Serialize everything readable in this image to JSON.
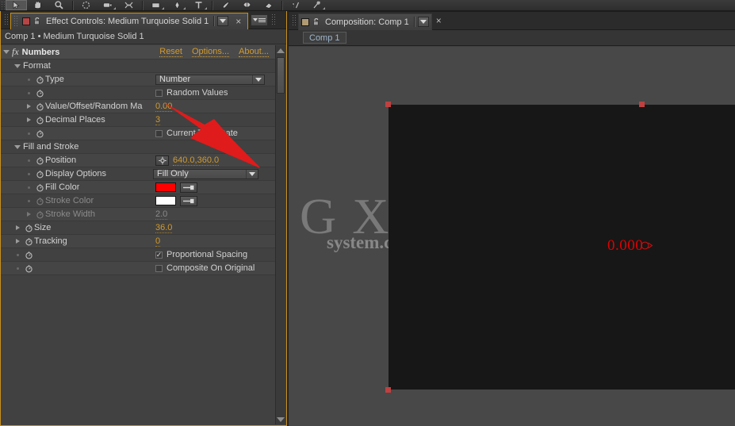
{
  "toolbar": {
    "name": "tools-toolbar",
    "tools": [
      {
        "name": "selection-tool",
        "icon": "arrow-cursor",
        "selected": true
      },
      {
        "name": "hand-tool",
        "icon": "hand"
      },
      {
        "name": "zoom-tool",
        "icon": "magnifier"
      },
      {
        "name": "rotation-tool",
        "icon": "rotate"
      },
      {
        "name": "camera-tool",
        "icon": "camera",
        "has_corner": true
      },
      {
        "name": "pan-behind-tool",
        "icon": "pan-behind"
      },
      {
        "name": "shape-tool",
        "icon": "rectangle",
        "has_corner": true
      },
      {
        "name": "pen-tool",
        "icon": "pen",
        "has_corner": true
      },
      {
        "name": "type-tool",
        "icon": "text-t",
        "has_corner": true
      },
      {
        "name": "brush-tool",
        "icon": "brush"
      },
      {
        "name": "clone-stamp-tool",
        "icon": "clone-stamp"
      },
      {
        "name": "eraser-tool",
        "icon": "eraser"
      },
      {
        "name": "roto-brush-tool",
        "icon": "roto-brush"
      },
      {
        "name": "puppet-pin-tool",
        "icon": "puppet-pin",
        "has_corner": true
      }
    ]
  },
  "effect_controls": {
    "tab_title": "Effect Controls: Medium Turquoise Solid 1",
    "breadcrumb": "Comp 1 • Medium Turquoise Solid 1",
    "close_glyph": "×",
    "effect": {
      "name": "Numbers",
      "fx_badge": "fx",
      "links": [
        {
          "name": "reset-link",
          "label": "Reset"
        },
        {
          "name": "options-link",
          "label": "Options..."
        },
        {
          "name": "about-link",
          "label": "About..."
        }
      ]
    },
    "groups": [
      {
        "name": "Format",
        "rows": [
          {
            "label": "Type",
            "kind": "select",
            "value": "Number"
          },
          {
            "label": "",
            "kind": "checkbox",
            "value": "Random Values",
            "checked": false
          },
          {
            "label": "Value/Offset/Random Ma",
            "kind": "value",
            "value": "0.00",
            "expandable": true
          },
          {
            "label": "Decimal Places",
            "kind": "value",
            "value": "3",
            "expandable": true
          },
          {
            "label": "",
            "kind": "checkbox",
            "value": "Current Time/Date",
            "checked": false
          }
        ]
      },
      {
        "name": "Fill and Stroke",
        "rows": [
          {
            "label": "Position",
            "kind": "position",
            "value": "640.0,360.0"
          },
          {
            "label": "Display Options",
            "kind": "select",
            "value": "Fill Only"
          },
          {
            "label": "Fill Color",
            "kind": "color",
            "value": "#ff0000"
          },
          {
            "label": "Stroke Color",
            "kind": "color",
            "value": "#ffffff",
            "disabled": true
          },
          {
            "label": "Stroke Width",
            "kind": "value",
            "value": "2.0",
            "expandable": true,
            "disabled": true
          },
          {
            "label": "Size",
            "kind": "value",
            "value": "36.0",
            "expandable": true,
            "indent": 0
          },
          {
            "label": "Tracking",
            "kind": "value",
            "value": "0",
            "expandable": true,
            "indent": 0
          },
          {
            "label": "",
            "kind": "checkbox",
            "value": "Proportional Spacing",
            "checked": true
          },
          {
            "label": "",
            "kind": "checkbox",
            "value": "Composite On Original",
            "checked": false
          }
        ]
      }
    ]
  },
  "composition": {
    "tab_title": "Composition: Comp 1",
    "close_glyph": "×",
    "comp_pill": "Comp 1",
    "render_text": "0.000"
  },
  "watermark": {
    "top": "G X I 网",
    "sub": "system.com"
  },
  "colors": {
    "panel_bg": "#414141",
    "tab_bg": "#2b2b2b",
    "accent_orange": "#d19a2e",
    "panel_border": "#c8901c",
    "fill_red": "#ff0000",
    "handle_red": "#c04040",
    "canvas_black": "#171717",
    "arrow_red": "#e01b1b"
  }
}
